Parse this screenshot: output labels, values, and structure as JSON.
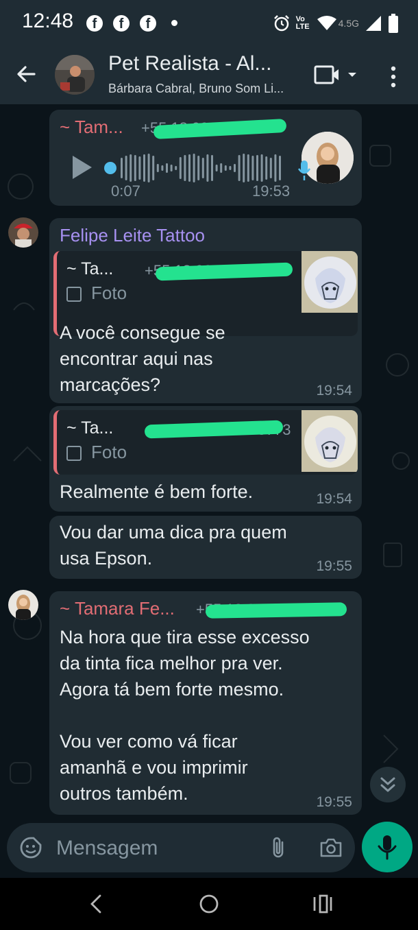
{
  "status_bar": {
    "time": "12:48",
    "network": "4.5G",
    "volte_top": "Vo",
    "volte_bottom": "LTE",
    "icons": [
      "facebook-icon",
      "facebook-icon",
      "facebook-icon",
      "alarm-icon",
      "wifi-icon",
      "signal-icon",
      "battery-icon"
    ]
  },
  "header": {
    "title": "Pet Realista - Al...",
    "subtitle": "Bárbara Cabral, Bruno Som Li..."
  },
  "messages": [
    {
      "type": "voice",
      "sender": "~ Tam...",
      "phone": "+55 18 99199-3773",
      "duration": "0:07",
      "time": "19:53"
    },
    {
      "type": "reply",
      "sender": "Felipe Leite Tattoo",
      "quote_sender": "~ Ta...",
      "quote_phone": "+55 18 99199-3773",
      "quote_label": "Foto",
      "text_lines": [
        "A você consegue se",
        "encontrar aqui nas",
        "marcações?"
      ],
      "time": "19:54"
    },
    {
      "type": "reply",
      "quote_sender": "~ Ta...",
      "quote_phone": "+55 18 99199-3773",
      "quote_label": "Foto",
      "text": "Realmente é bem forte.",
      "time": "19:54"
    },
    {
      "type": "text",
      "text_lines": [
        "Vou dar uma dica pra quem",
        "usa Epson."
      ],
      "time": "19:55"
    },
    {
      "type": "text",
      "sender": "~ Tamara Fe...",
      "phone": "+55 18 99199-3773",
      "text_lines": [
        "Na hora que tira esse excesso",
        "da tinta fica melhor pra ver.",
        "Agora tá bem forte mesmo.",
        "",
        "Vou ver como vá ficar",
        "amanhã e vou imprimir",
        "outros também."
      ],
      "time": "19:55"
    }
  ],
  "input": {
    "placeholder": "Mensagem"
  },
  "colors": {
    "background": "#0b141a",
    "bubble": "#202c33",
    "header": "#1f2c34",
    "accent": "#00a884",
    "sender_red": "#e26d74",
    "sender_purple": "#a791f1",
    "voice_dot": "#53bdeb"
  }
}
